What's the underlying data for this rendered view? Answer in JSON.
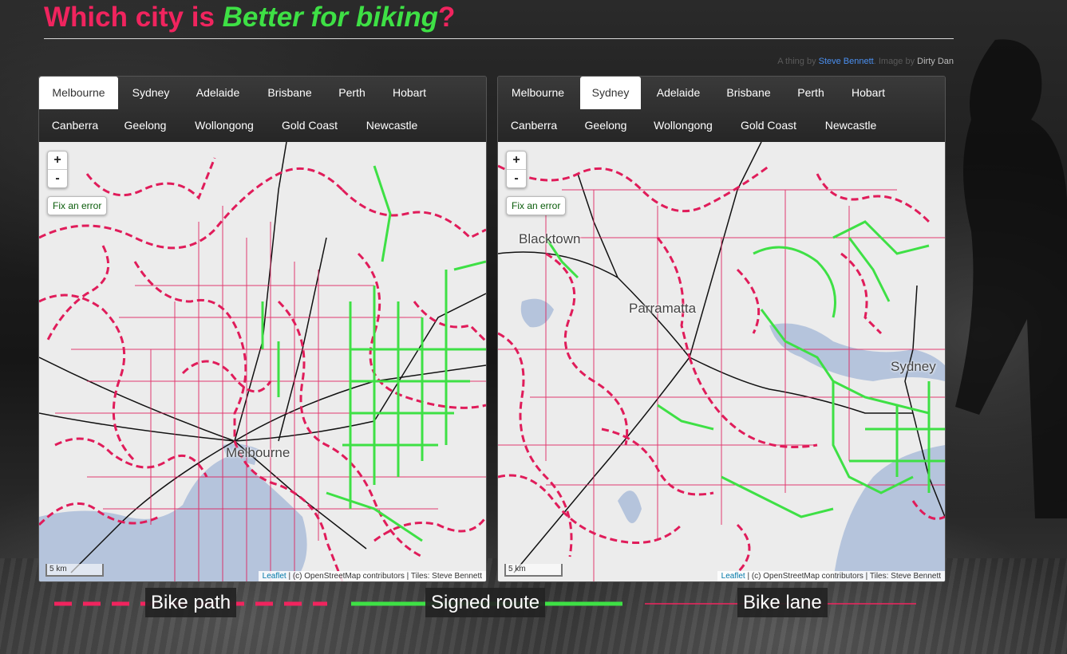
{
  "header": {
    "title_prefix": "Which city is ",
    "title_emph": "Better for biking",
    "title_suffix": "?"
  },
  "credit": {
    "text1": "A thing by ",
    "author": "Steve Bennett",
    "text2": ". Image by ",
    "image_author": "Dirty Dan"
  },
  "panels": [
    {
      "tabs": [
        "Melbourne",
        "Sydney",
        "Adelaide",
        "Brisbane",
        "Perth",
        "Hobart",
        "Canberra",
        "Geelong",
        "Wollongong",
        "Gold Coast",
        "Newcastle"
      ],
      "active_tab": "Melbourne",
      "places": [
        "Melbourne"
      ],
      "zoom_in": "+",
      "zoom_out": "-",
      "fix_error": "Fix an error",
      "scale": "5 km",
      "attrib_leaflet": "Leaflet",
      "attrib_text": " | (c) OpenStreetMap contributors | Tiles: Steve Bennett"
    },
    {
      "tabs": [
        "Melbourne",
        "Sydney",
        "Adelaide",
        "Brisbane",
        "Perth",
        "Hobart",
        "Canberra",
        "Geelong",
        "Wollongong",
        "Gold Coast",
        "Newcastle"
      ],
      "active_tab": "Sydney",
      "places": [
        "Blacktown",
        "Parramatta",
        "Sydney"
      ],
      "zoom_in": "+",
      "zoom_out": "-",
      "fix_error": "Fix an error",
      "scale": "5 km",
      "attrib_leaflet": "Leaflet",
      "attrib_text": " | (c) OpenStreetMap contributors | Tiles: Steve Bennett"
    }
  ],
  "legend": {
    "bike_path": "Bike path",
    "signed_route": "Signed route",
    "bike_lane": "Bike lane"
  },
  "colors": {
    "pink": "#f0245e",
    "green": "#3ee045",
    "water": "#b5c4dc"
  }
}
